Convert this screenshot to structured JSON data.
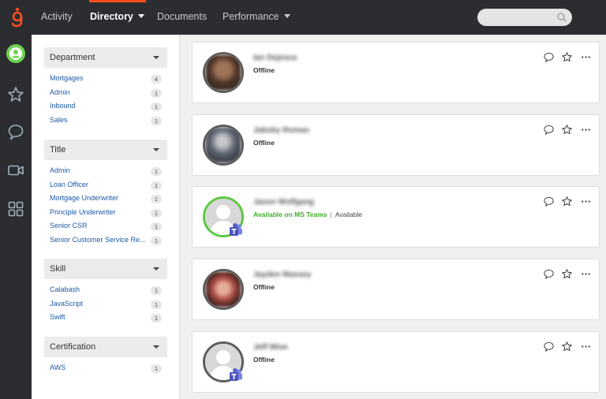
{
  "nav": {
    "items": [
      {
        "label": "Activity",
        "active": false,
        "dropdown": false
      },
      {
        "label": "Directory",
        "active": true,
        "dropdown": true
      },
      {
        "label": "Documents",
        "active": false,
        "dropdown": false
      },
      {
        "label": "Performance",
        "active": false,
        "dropdown": true
      }
    ],
    "search_placeholder": ""
  },
  "rail": {
    "icons": [
      "profile-avatar",
      "star-icon",
      "chat-icon",
      "video-icon",
      "apps-icon"
    ]
  },
  "filters": [
    {
      "title": "Department",
      "items": [
        {
          "label": "Mortgages",
          "count": "4"
        },
        {
          "label": "Admin",
          "count": "1"
        },
        {
          "label": "Inbound",
          "count": "1"
        },
        {
          "label": "Sales",
          "count": "1"
        }
      ]
    },
    {
      "title": "Title",
      "items": [
        {
          "label": "Admin",
          "count": "1"
        },
        {
          "label": "Loan Officer",
          "count": "1"
        },
        {
          "label": "Mortgage Underwriter",
          "count": "1"
        },
        {
          "label": "Principle Underwriter",
          "count": "1"
        },
        {
          "label": "Senior CSR",
          "count": "1"
        },
        {
          "label": "Senior Customer Service Re...",
          "count": "1"
        }
      ]
    },
    {
      "title": "Skill",
      "items": [
        {
          "label": "Calabash",
          "count": "1"
        },
        {
          "label": "JavaScript",
          "count": "1"
        },
        {
          "label": "Swift",
          "count": "1"
        }
      ]
    },
    {
      "title": "Certification",
      "items": [
        {
          "label": "AWS",
          "count": "1"
        }
      ]
    }
  ],
  "people": [
    {
      "name": "Ian Dejesus",
      "status": "Offline",
      "substatus": "",
      "online": false,
      "photo": true,
      "teams": false
    },
    {
      "name": "Jakoby Roman",
      "status": "Offline",
      "substatus": "",
      "online": false,
      "photo": true,
      "teams": false
    },
    {
      "name": "Jason Wolfgang",
      "status": "Available on MS Teams",
      "substatus": "Available",
      "online": true,
      "photo": false,
      "teams": true
    },
    {
      "name": "Jayden Massey",
      "status": "Offline",
      "substatus": "",
      "online": false,
      "photo": true,
      "teams": false
    },
    {
      "name": "Jeff Wise",
      "status": "Offline",
      "substatus": "",
      "online": false,
      "photo": false,
      "teams": true
    }
  ],
  "colors": {
    "topbar": "#2b2d31",
    "accent": "#ff4f1f",
    "online": "#5cc93f",
    "link": "#1e5aa6",
    "teams": "#5b5fc7"
  }
}
